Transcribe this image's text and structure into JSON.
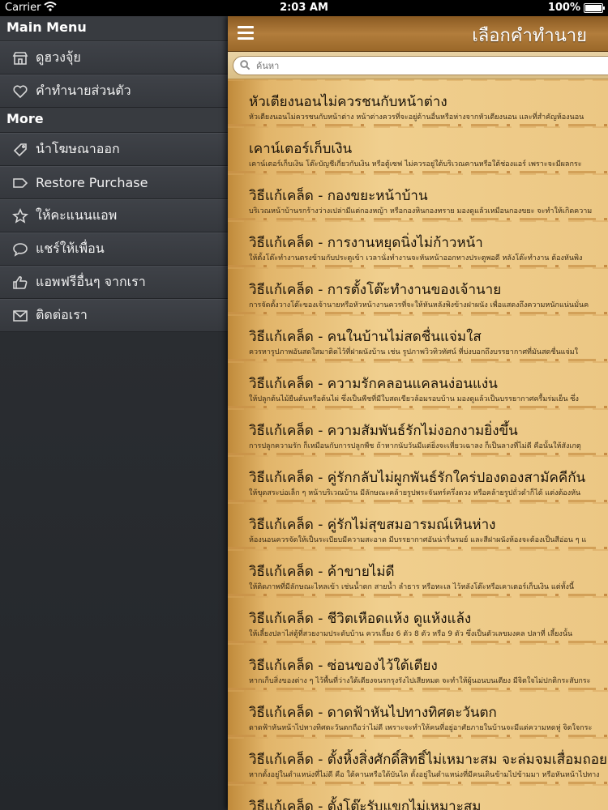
{
  "status_bar": {
    "carrier": "Carrier",
    "time": "2:03 AM",
    "battery": "100%"
  },
  "sidebar": {
    "main_menu_header": "Main Menu",
    "main_items": [
      {
        "label": "ดูฮวงจุ้ย",
        "icon": "store-icon"
      },
      {
        "label": "คำทำนายส่วนตัว",
        "icon": "heart-icon"
      }
    ],
    "more_header": "More",
    "more_items": [
      {
        "label": "นำโฆษณาออก",
        "icon": "tag-icon"
      },
      {
        "label": "Restore Purchase",
        "icon": "label-icon"
      },
      {
        "label": "ให้คะแนนแอพ",
        "icon": "star-icon"
      },
      {
        "label": "แชร์ให้เพื่อน",
        "icon": "chat-bubble-icon"
      },
      {
        "label": "แอพฟรีอื่นๆ จากเรา",
        "icon": "thumbs-up-icon"
      },
      {
        "label": "ติดต่อเรา",
        "icon": "envelope-icon"
      }
    ]
  },
  "navbar": {
    "title": "เลือกคำทำนาย",
    "menu_icon": "hamburger-icon"
  },
  "search": {
    "placeholder": "ค้นหา"
  },
  "list": [
    {
      "title": "หัวเตียงนอนไม่ควรชนกับหน้าต่าง",
      "subtitle": "หัวเตียงนอนไม่ควรชนกับหน้าต่าง  หน้าต่างควรที่จะอยู่ด้านอื่นหรือห่างจากหัวเตียงนอน  และที่สำคัญห้องนอน"
    },
    {
      "title": "เคาน์เตอร์เก็บเงิน",
      "subtitle": "เคาน์เตอร์เก็บเงิน โต๊ะบัญชีเกี่ยวกับเงิน  หรือตู้เซฟ  ไม่ควรอยู่ใต้บริเวณคานหรือใต้ช่องแอร์  เพราะจะมีผลกระ"
    },
    {
      "title": "วิธีแก้เคล็ด - กองขยะหน้าบ้าน",
      "subtitle": "บริเวณหน้าบ้านรกร้างว่างเปล่ามีแต่กองหญ้า  หรือกองหินกองทราย มองดูแล้วเหมือนกองขยะ  จะทำให้เกิดความ"
    },
    {
      "title": "วิธีแก้เคล็ด - การงานหยุดนิ่งไม่ก้าวหน้า",
      "subtitle": "ให้ตั้งโต๊ะทำงานตรงข้ามกับประตูเข้า  เวลานั่งทำงานจะหันหน้าออกทางประตูพอดี  หลังโต๊ะทำงาน ต้องหันพิง"
    },
    {
      "title": "วิธีแก้เคล็ด - การตั้งโต๊ะทำงานของเจ้านาย",
      "subtitle": "การจัดตั้งวางโต๊ะของเจ้านายหรือหัวหน้างานควรที่จะให้หันหลังพิงข้างฝาผนัง  เพื่อแสดงถึงความหนักแน่นมั่นค"
    },
    {
      "title": "วิธีแก้เคล็ด - คนในบ้านไม่สดชื่นแจ่มใส",
      "subtitle": "ควรหารูปภาพอันสดใสมาติดไว้ที่ฝาผนังบ้าน  เช่น รูปภาพวิวทิวทัศน์  ที่บ่งบอกถึงบรรยากาศที่มันสดชื่นแจ่มใ"
    },
    {
      "title": "วิธีแก้เคล็ด - ความรักคลอนแคลนง่อนแง่น",
      "subtitle": "ให้ปลูกต้นไม้ยืนต้นหรือต้นไผ่  ซึ่งเป็นพืชที่มีใบสดเขียวล้อมรอบบ้าน  มองดูแล้วเป็นบรรยากาศครื้มร่มเย็น ซึ่ง"
    },
    {
      "title": "วิธีแก้เคล็ด - ความสัมพันธ์รักไม่งอกงามยิ่งขึ้น",
      "subtitle": "การปลูกความรัก  ก็เหมือนกับการปลูกพืช  ถ้าหากนับวันมีแต่ยิ่งจะเหี่ยวเฉาลง  ก็เป็นลางที่ไม่ดี  คือนั้นให้สังเกตุ"
    },
    {
      "title": "วิธีแก้เคล็ด - คู่รักกลับไม่ผูกพันธ์รักใคร่ปองดองสามัคคีกัน",
      "subtitle": "ให้ขุดสระบ่อเล็ก ๆ หน้าบริเวณบ้าน มีลักษณะคล้ายรูปพระจันทร์ครึ่งดวง หรือคล้ายรูปถั่วดำก็ได้  แต่งต้องหัน"
    },
    {
      "title": "วิธีแก้เคล็ด - คู่รักไม่สุขสมอารมณ์เหินห่าง",
      "subtitle": "ห้องนอนควรจัดให้เป็นระเบียบมีความสะอาด มีบรรยากาศอันน่ารื่นรมย์  และสีฝาผนังห้องจะต้องเป็นสีอ่อน ๆ แ"
    },
    {
      "title": "วิธีแก้เคล็ด - ค้าขายไม่ดี",
      "subtitle": "ให้ติดภาพที่มีลักษณะไหลเข้า  เช่นน้ำตก  สายน้ำ  ลำธาร   หรือทะเล  ไว้หลังโต๊ะหรือเคาเตอร์เก็บเงิน  แต่ทั้งนี้"
    },
    {
      "title": "วิธีแก้เคล็ด - ชีวิตเหือดแห้ง  ดูแห้งแล้ง",
      "subtitle": "ให้เลี้ยงปลาไส่ตู้ที่สวยงามประดับบ้าน  ควรเลี้ยง  6 ตัว  8  ตัว หรือ  9  ตัว ซึ่งเป็นตัวเลขมงคล  ปลาที่ เลี้ยงนั้น"
    },
    {
      "title": "วิธีแก้เคล็ด - ซ่อนของไว้ใต้เตียง",
      "subtitle": "หากเก็บสิ่งของต่าง ๆ ไว้พื้นที่ว่างใต้เตียงจนรกรุงรังไปเสียหมด  จะทำให้ผู้นอนบนเตียง มีจิตใจไม่ปกติกระสับกระ"
    },
    {
      "title": "วิธีแก้เคล็ด - ดาดฟ้าหันไปทางทิศตะวันตก",
      "subtitle": "ดาดฟ้าหันหน้าไปทางทิศตะวันตกถือว่าไม่ดี  เพราะจะทำให้คนที่อยู่อาศัยภายในบ้านจะมีแต่ความหดหู่  จิตใจกระ"
    },
    {
      "title": "วิธีแก้เคล็ด - ตั้งหิ้งสิ่งศักดิ์สิทธิ์ไม่เหมาะสม จะล่มจมเสื่อมถอย",
      "subtitle": "หากตั้งอยู่ในตำแหน่งที่ไม่ดี คือ ใต้คานหรือใต้บันได  ตั้งอยู่ในตำแหน่งที่มีคนเดินข้ามไปข้ามมา  หรือหันหน้าไปทาง"
    },
    {
      "title": "วิธีแก้เคล็ด - ตั้งโต๊ะรับแขกไม่เหมาะสม",
      "subtitle": ""
    }
  ]
}
